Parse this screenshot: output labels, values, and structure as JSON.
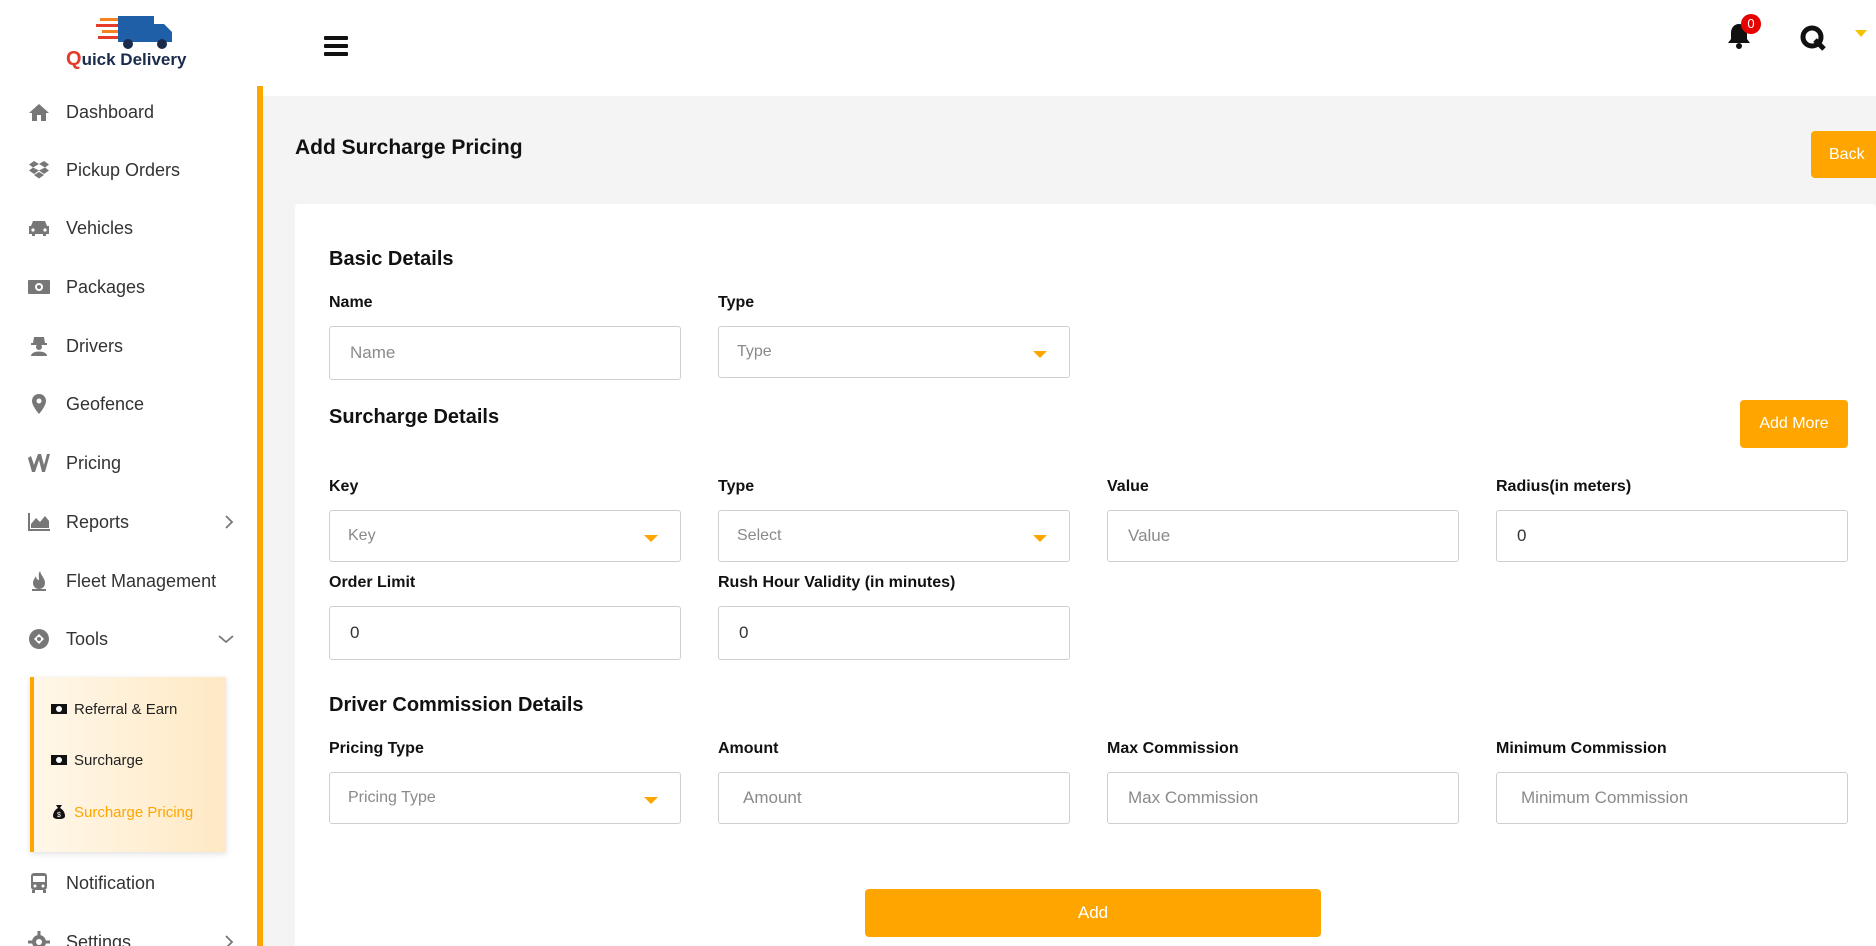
{
  "app": {
    "logo_text_q": "Q",
    "logo_text_rest": "uick Delivery"
  },
  "sidebar": {
    "items": [
      {
        "label": "Dashboard",
        "icon": "home-icon"
      },
      {
        "label": "Pickup Orders",
        "icon": "dropbox-icon"
      },
      {
        "label": "Vehicles",
        "icon": "car-icon"
      },
      {
        "label": "Packages",
        "icon": "money-icon"
      },
      {
        "label": "Drivers",
        "icon": "user-secret-icon"
      },
      {
        "label": "Geofence",
        "icon": "map-pin-icon"
      },
      {
        "label": "Pricing",
        "icon": "pricing-icon"
      },
      {
        "label": "Reports",
        "icon": "area-chart-icon"
      },
      {
        "label": "Fleet Management",
        "icon": "fire-icon"
      },
      {
        "label": "Tools",
        "icon": "tools-icon"
      },
      {
        "label": "Notification",
        "icon": "bus-icon"
      },
      {
        "label": "Settings",
        "icon": "gear-icon"
      }
    ],
    "tools_submenu": [
      {
        "label": "Referral & Earn",
        "icon": "money-icon"
      },
      {
        "label": "Surcharge",
        "icon": "money-icon"
      },
      {
        "label": "Surcharge Pricing",
        "icon": "money-bag-icon",
        "active": true
      }
    ]
  },
  "topbar": {
    "notification_count": "0"
  },
  "page": {
    "title": "Add Surcharge Pricing",
    "back_label": "Back"
  },
  "basic": {
    "title": "Basic Details",
    "name_label": "Name",
    "name_placeholder": "Name",
    "type_label": "Type",
    "type_value": "Type"
  },
  "surcharge": {
    "title": "Surcharge Details",
    "add_more_label": "Add More",
    "key_label": "Key",
    "key_value": "Key",
    "type_label": "Type",
    "type_value": "Select",
    "value_label": "Value",
    "value_placeholder": "Value",
    "radius_label": "Radius(in meters)",
    "radius_value": "0",
    "order_limit_label": "Order Limit",
    "order_limit_value": "0",
    "rush_label": "Rush Hour Validity (in minutes)",
    "rush_value": "0"
  },
  "commission": {
    "title": "Driver Commission Details",
    "pricing_type_label": "Pricing Type",
    "pricing_type_value": "Pricing Type",
    "amount_label": "Amount",
    "amount_placeholder": "Amount",
    "max_label": "Max Commission",
    "max_placeholder": "Max Commission",
    "min_label": "Minimum Commission",
    "min_placeholder": "Minimum Commission"
  },
  "actions": {
    "add_label": "Add"
  },
  "colors": {
    "accent": "#FFA500",
    "badge": "#E60000"
  }
}
